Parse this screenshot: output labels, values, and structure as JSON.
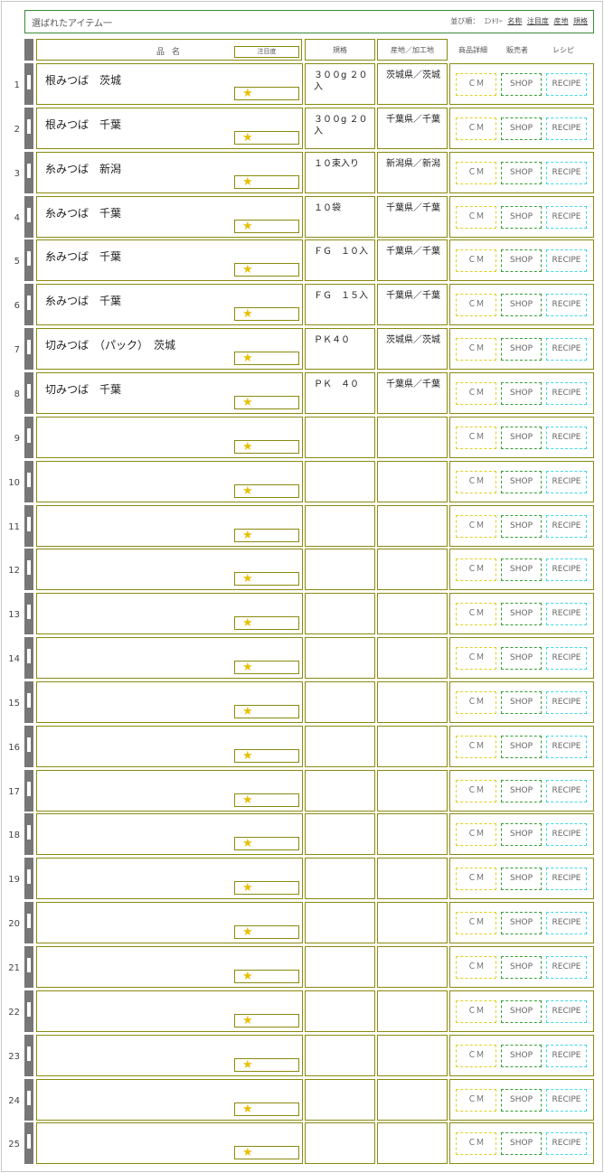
{
  "header": {
    "title": "選ばれたアイテム一",
    "sort_label": "並び順：",
    "sort_entry": "ｴﾝﾄﾘｰ",
    "sort_name": "名称",
    "sort_attention": "注目度",
    "sort_origin": "産地",
    "sort_spec": "規格"
  },
  "columns": {
    "name": "品名",
    "attention": "注目度",
    "spec": "規格",
    "origin": "産地／加工地",
    "detail": "商品詳細",
    "seller": "販売者",
    "recipe": "レシピ"
  },
  "buttons": {
    "cm": "ＣＭ",
    "shop": "SHOP",
    "recipe": "RECIPE"
  },
  "star": "★",
  "rows": [
    {
      "num": "1",
      "name": "根みつば　茨城",
      "spec": "３００g ２０入",
      "origin": "茨城県／茨城"
    },
    {
      "num": "2",
      "name": "根みつば　千葉",
      "spec": "３００g ２０入",
      "origin": "千葉県／千葉"
    },
    {
      "num": "3",
      "name": "糸みつば　新潟",
      "spec": "１０束入り",
      "origin": "新潟県／新潟"
    },
    {
      "num": "4",
      "name": "糸みつば　千葉",
      "spec": "１０袋",
      "origin": "千葉県／千葉"
    },
    {
      "num": "5",
      "name": "糸みつば　千葉",
      "spec": "ＦＧ　１０入",
      "origin": "千葉県／千葉"
    },
    {
      "num": "6",
      "name": "糸みつば　千葉",
      "spec": "ＦＧ　１５入",
      "origin": "千葉県／千葉"
    },
    {
      "num": "7",
      "name": "切みつば　（パック）　茨城",
      "spec": "ＰＫ４０",
      "origin": "茨城県／茨城"
    },
    {
      "num": "8",
      "name": "切みつば　千葉",
      "spec": "ＰＫ　４０",
      "origin": "千葉県／千葉"
    },
    {
      "num": "9",
      "name": "",
      "spec": "",
      "origin": ""
    },
    {
      "num": "10",
      "name": "",
      "spec": "",
      "origin": ""
    },
    {
      "num": "11",
      "name": "",
      "spec": "",
      "origin": ""
    },
    {
      "num": "12",
      "name": "",
      "spec": "",
      "origin": ""
    },
    {
      "num": "13",
      "name": "",
      "spec": "",
      "origin": ""
    },
    {
      "num": "14",
      "name": "",
      "spec": "",
      "origin": ""
    },
    {
      "num": "15",
      "name": "",
      "spec": "",
      "origin": ""
    },
    {
      "num": "16",
      "name": "",
      "spec": "",
      "origin": ""
    },
    {
      "num": "17",
      "name": "",
      "spec": "",
      "origin": ""
    },
    {
      "num": "18",
      "name": "",
      "spec": "",
      "origin": ""
    },
    {
      "num": "19",
      "name": "",
      "spec": "",
      "origin": ""
    },
    {
      "num": "20",
      "name": "",
      "spec": "",
      "origin": ""
    },
    {
      "num": "21",
      "name": "",
      "spec": "",
      "origin": ""
    },
    {
      "num": "22",
      "name": "",
      "spec": "",
      "origin": ""
    },
    {
      "num": "23",
      "name": "",
      "spec": "",
      "origin": ""
    },
    {
      "num": "24",
      "name": "",
      "spec": "",
      "origin": ""
    },
    {
      "num": "25",
      "name": "",
      "spec": "",
      "origin": ""
    }
  ]
}
